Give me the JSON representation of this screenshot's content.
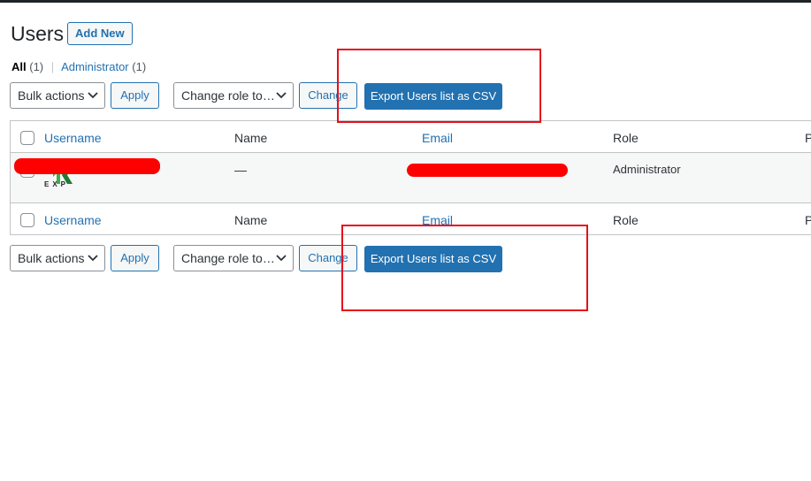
{
  "header": {
    "title": "Users",
    "add_new": "Add New"
  },
  "views": {
    "all_label": "All",
    "all_count": "(1)",
    "admin_label": "Administrator",
    "admin_count": "(1)",
    "separator": "|"
  },
  "top_actions": {
    "bulk_actions": "Bulk actions",
    "apply": "Apply",
    "change_role": "Change role to…",
    "change": "Change",
    "export": "Export Users list as CSV"
  },
  "bottom_actions": {
    "bulk_actions": "Bulk actions",
    "apply": "Apply",
    "change_role": "Change role to…",
    "change": "Change",
    "export": "Export Users list as CSV"
  },
  "table": {
    "columns": [
      "Username",
      "Name",
      "Email",
      "Role",
      "P"
    ],
    "rows": [
      {
        "name": "—",
        "role": "Administrator",
        "logo_text": "EXP"
      }
    ]
  },
  "colors": {
    "accent": "#2271b1",
    "annotation": "#e5101c",
    "redaction": "#ff0000"
  }
}
